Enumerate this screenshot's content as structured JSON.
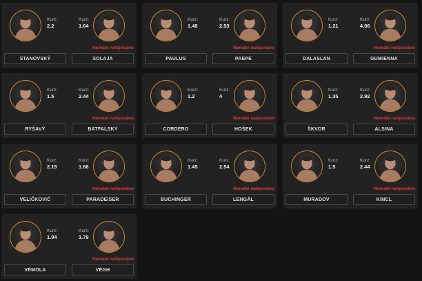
{
  "colors": {
    "background": "#141414",
    "card": "#222222",
    "avatar_ring": "#c8872e",
    "warning": "#e03a3a"
  },
  "labels": {
    "odds": "Kurz:",
    "not_bet": "Nemáte natipováno"
  },
  "matches": [
    {
      "left": {
        "name": "STANOVSKÝ",
        "odds": "2.2"
      },
      "right": {
        "name": "SOLAJA",
        "odds": "1.64"
      },
      "status": "Nemáte natipováno"
    },
    {
      "left": {
        "name": "PAULUS",
        "odds": "1.48"
      },
      "right": {
        "name": "PAEPE",
        "odds": "2.53"
      },
      "status": "Nemáte natipováno"
    },
    {
      "left": {
        "name": "DALASLAN",
        "odds": "1.21"
      },
      "right": {
        "name": "GUMIENNA",
        "odds": "4.06"
      },
      "status": "Nemáte natipováno"
    },
    {
      "left": {
        "name": "RYŠAVÝ",
        "odds": "1.5"
      },
      "right": {
        "name": "BATFALSKÝ",
        "odds": "2.44"
      },
      "status": "Nemáte natipováno"
    },
    {
      "left": {
        "name": "CORDERO",
        "odds": "1.2"
      },
      "right": {
        "name": "HOŠEK",
        "odds": "4"
      },
      "status": "Nemáte natipováno"
    },
    {
      "left": {
        "name": "ŠKVOR",
        "odds": "1.35"
      },
      "right": {
        "name": "ALSINA",
        "odds": "2.92"
      },
      "status": "Nemáte natipováno"
    },
    {
      "left": {
        "name": "VELIČKOVIĆ",
        "odds": "2.15"
      },
      "right": {
        "name": "PARADEISER",
        "odds": "1.66"
      },
      "status": "Nemáte natipováno"
    },
    {
      "left": {
        "name": "BUCHINGER",
        "odds": "1.45"
      },
      "right": {
        "name": "LENGÁL",
        "odds": "2.54"
      },
      "status": "Nemáte natipováno"
    },
    {
      "left": {
        "name": "MURADOV",
        "odds": "1.5"
      },
      "right": {
        "name": "KINCL",
        "odds": "2.44"
      },
      "status": "Nemáte natipováno"
    },
    {
      "left": {
        "name": "VÉMOLA",
        "odds": "1.94"
      },
      "right": {
        "name": "VÉGH",
        "odds": "1.79"
      },
      "status": "Nemáte natipováno"
    }
  ]
}
